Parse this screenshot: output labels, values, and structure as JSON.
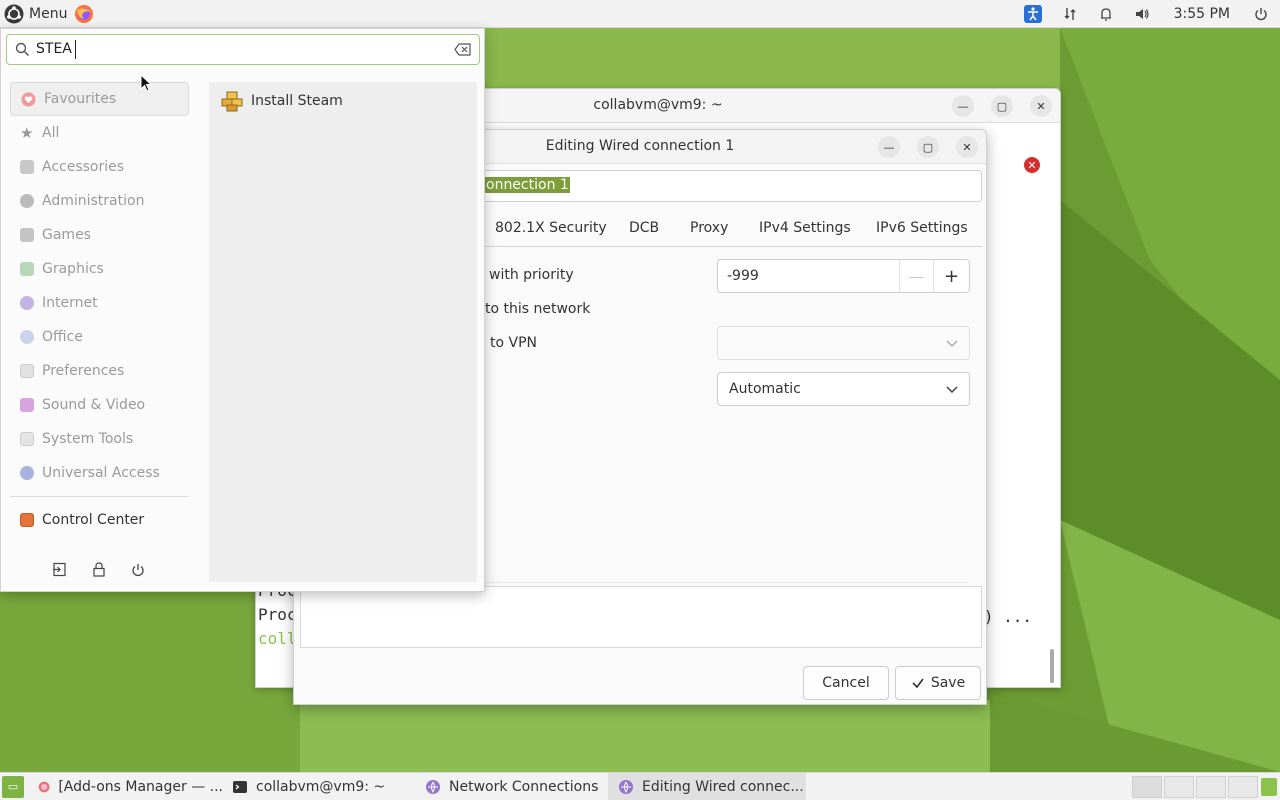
{
  "top_panel": {
    "menu_label": "Menu",
    "clock": "3:55 PM",
    "tray_icons": [
      "accessibility-icon",
      "network-icon",
      "notifications-icon",
      "volume-icon",
      "power-icon"
    ]
  },
  "app_menu": {
    "search_value": "STEA",
    "categories": [
      {
        "label": "Favourites",
        "icon": "heart-icon",
        "color": "#e57373"
      },
      {
        "label": "All",
        "icon": "star-icon",
        "color": "#9e9e9e"
      },
      {
        "label": "Accessories",
        "icon": "accessories-icon",
        "color": "#bdbdbd"
      },
      {
        "label": "Administration",
        "icon": "administration-icon",
        "color": "#bdbdbd"
      },
      {
        "label": "Games",
        "icon": "games-icon",
        "color": "#bdbdbd"
      },
      {
        "label": "Graphics",
        "icon": "graphics-icon",
        "color": "#a5d6a7"
      },
      {
        "label": "Internet",
        "icon": "internet-icon",
        "color": "#b39ddb"
      },
      {
        "label": "Office",
        "icon": "office-icon",
        "color": "#c5cae9"
      },
      {
        "label": "Preferences",
        "icon": "preferences-icon",
        "color": "#e0e0e0"
      },
      {
        "label": "Sound & Video",
        "icon": "sound-video-icon",
        "color": "#ce93d8"
      },
      {
        "label": "System Tools",
        "icon": "system-tools-icon",
        "color": "#e0e0e0"
      },
      {
        "label": "Universal Access",
        "icon": "universal-access-icon",
        "color": "#9fa8da"
      }
    ],
    "control_center": "Control Center",
    "results": [
      {
        "label": "Install Steam",
        "icon": "steam-installer-icon"
      }
    ]
  },
  "terminal": {
    "title": "collabvm@vm9: ~",
    "lines": [
      "Proc",
      "Proc",
      "coll"
    ],
    "trailing": ") ..."
  },
  "dialog": {
    "title": "Editing Wired connection 1",
    "connection_name_visible": "onnection 1",
    "tabs": [
      "802.1X Security",
      "DCB",
      "Proxy",
      "IPv4 Settings",
      "IPv6 Settings"
    ],
    "labels": {
      "priority": "with priority",
      "network": "to this network",
      "vpn": "to VPN"
    },
    "priority_value": "-999",
    "vpn_value": "",
    "firewall_zone_value": "Automatic",
    "cancel_label": "Cancel",
    "save_label": "Save"
  },
  "taskbar": {
    "tasks": [
      {
        "label": "[Add-ons Manager — ...",
        "icon": "firefox-icon"
      },
      {
        "label": "collabvm@vm9: ~",
        "icon": "terminal-icon"
      },
      {
        "label": "Network Connections",
        "icon": "network-connections-icon"
      },
      {
        "label": "Editing Wired connec...",
        "icon": "network-connections-icon"
      }
    ]
  },
  "colors": {
    "accent": "#7e9e3a",
    "error": "#d32f2f"
  }
}
